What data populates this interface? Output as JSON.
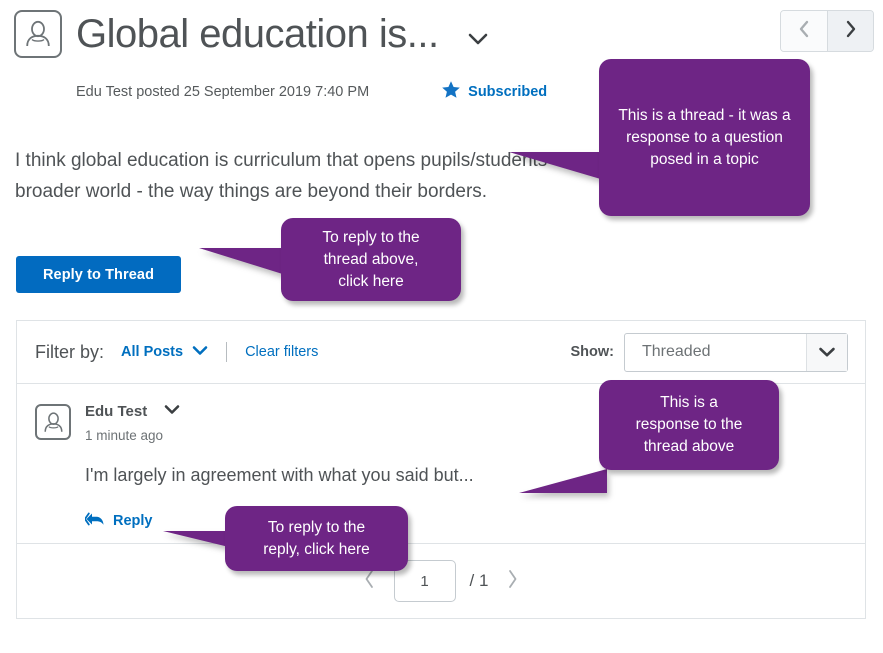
{
  "header": {
    "title": "Global education is...",
    "title_caret_icon": "chevron-down-icon",
    "avatar_icon": "user-avatar-icon",
    "byline": "Edu Test posted 25 September 2019 7:40 PM",
    "subscribed_label": "Subscribed",
    "star_icon": "star-filled-icon",
    "nav": {
      "prev_icon": "chevron-left-icon",
      "next_icon": "chevron-right-icon"
    }
  },
  "thread": {
    "body": "I think global education is curriculum that opens pupils/students broader world - the way things are beyond their borders.",
    "reply_button_label": "Reply to Thread"
  },
  "filter_bar": {
    "filter_label": "Filter by:",
    "filter_value": "All Posts",
    "filter_caret_icon": "chevron-down-icon",
    "clear_filters_label": "Clear filters",
    "show_label": "Show:",
    "show_value": "Threaded",
    "show_caret_icon": "chevron-down-icon"
  },
  "posts": [
    {
      "avatar_icon": "user-avatar-icon",
      "author": "Edu Test",
      "author_caret_icon": "chevron-down-icon",
      "time": "1 minute ago",
      "text": "I'm largely in agreement with what you said but...",
      "reply_label": "Reply",
      "reply_icon": "reply-arrow-icon"
    }
  ],
  "pagination": {
    "prev_icon": "chevron-left-icon",
    "current_page": "1",
    "total_pages": "/ 1",
    "next_icon": "chevron-right-icon"
  },
  "callouts": {
    "thread": "This is a thread - it was a response to a question posed in a topic",
    "reply_to_thread": "To reply to the\nthread above,\nclick here",
    "response": "This is a\nresponse to the\nthread above",
    "reply_to_reply": "To reply to the\nreply, click here"
  },
  "colors": {
    "callout_purple": "#6e2585",
    "link_blue": "#006fbf",
    "button_blue": "#026bc0",
    "text_grey": "#4f5356"
  }
}
